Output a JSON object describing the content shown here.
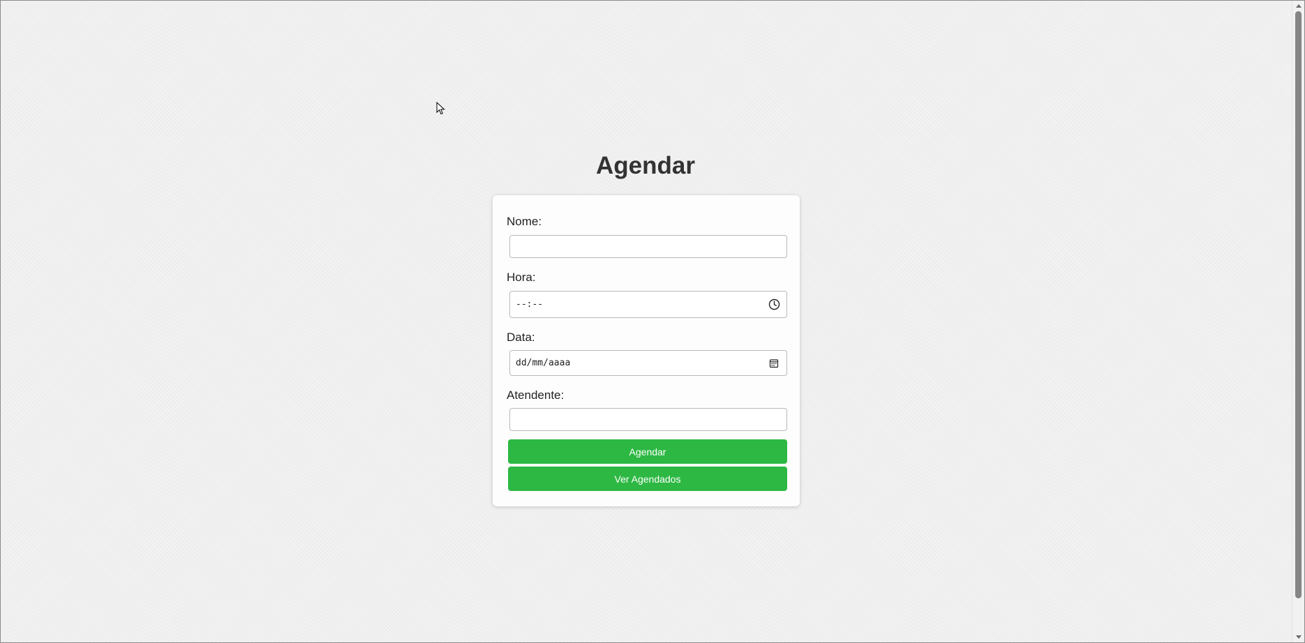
{
  "page": {
    "title": "Agendar"
  },
  "form": {
    "fields": [
      {
        "label": "Nome:",
        "value": "",
        "placeholder": ""
      },
      {
        "label": "Hora:",
        "display": "--:--",
        "icon": "clock-icon"
      },
      {
        "label": "Data:",
        "display": "dd/mm/aaaa",
        "icon": "calendar-icon"
      },
      {
        "label": "Atendente:",
        "value": "",
        "placeholder": ""
      }
    ],
    "buttons": {
      "submit_label": "Agendar",
      "list_label": "Ver Agendados"
    }
  },
  "colors": {
    "button_green": "#2db843",
    "background": "#f2f2f2",
    "card": "#fdfdfd"
  }
}
